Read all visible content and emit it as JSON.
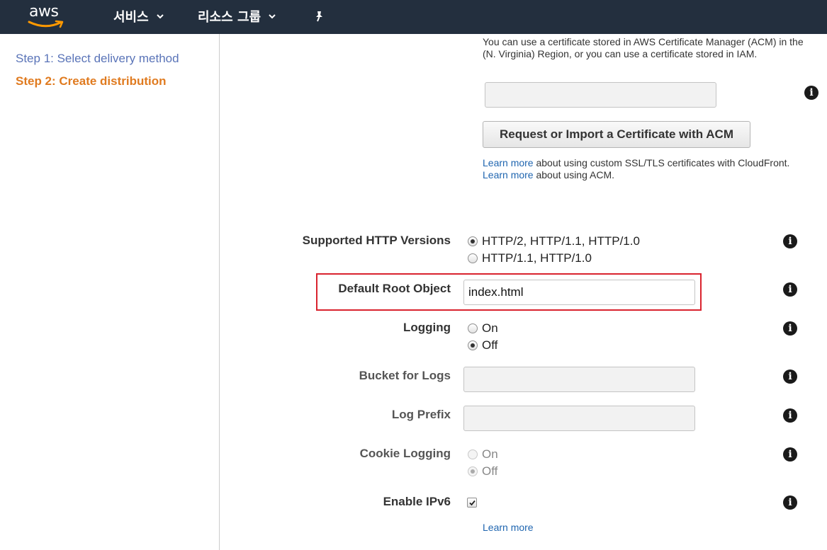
{
  "topnav": {
    "logo_text": "aws",
    "services_label": "서비스",
    "resource_groups_label": "리소스 그룹",
    "icons": [
      "chevron-down-icon",
      "pin-icon"
    ]
  },
  "sidebar": {
    "steps": [
      {
        "label": "Step 1: Select delivery method"
      },
      {
        "label": "Step 2: Create distribution"
      }
    ]
  },
  "certificate": {
    "note_line1": "You can use a certificate stored in AWS Certificate Manager (ACM) in the",
    "note_line2": "(N. Virginia) Region, or you can use a certificate stored in IAM.",
    "input_value": "",
    "acm_button": "Request or Import a Certificate with ACM",
    "learn_link": "Learn more",
    "learn_text_1": " about using custom SSL/TLS certificates with CloudFront.",
    "learn_text_2": " about using ACM."
  },
  "form": {
    "http_versions": {
      "label": "Supported HTTP Versions",
      "options": [
        "HTTP/2, HTTP/1.1, HTTP/1.0",
        "HTTP/1.1, HTTP/1.0"
      ],
      "selected": "HTTP/2, HTTP/1.1, HTTP/1.0"
    },
    "default_root_object": {
      "label": "Default Root Object",
      "value": "index.html"
    },
    "logging": {
      "label": "Logging",
      "options": [
        "On",
        "Off"
      ],
      "selected": "Off"
    },
    "bucket_for_logs": {
      "label": "Bucket for Logs",
      "value": ""
    },
    "log_prefix": {
      "label": "Log Prefix",
      "value": ""
    },
    "cookie_logging": {
      "label": "Cookie Logging",
      "options": [
        "On",
        "Off"
      ],
      "selected": "Off",
      "disabled": true
    },
    "enable_ipv6": {
      "label": "Enable IPv6",
      "checked": true
    },
    "learn_more": "Learn more"
  },
  "info_icon": {
    "glyph": "i",
    "color": "#1a1a1a"
  },
  "colors": {
    "nav_bg": "#232f3e",
    "step_active": "#e07b20",
    "step_link": "#5a74b8",
    "link": "#2066b0",
    "highlight": "#d9232e"
  }
}
